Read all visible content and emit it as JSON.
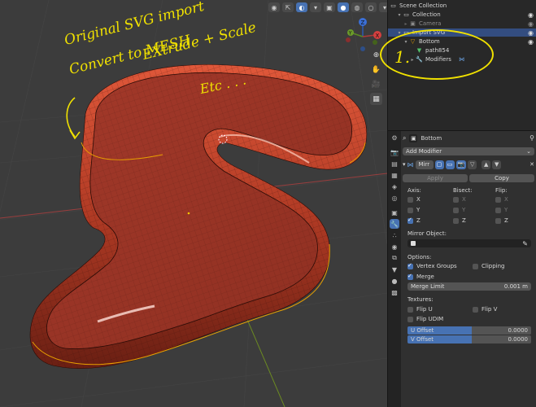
{
  "viewport": {
    "header_icons": [
      "eye-toggle-icon",
      "sphere-shading-icon",
      "overlay-icon",
      "xray-icon",
      "solid-shading-icon",
      "material-shading-icon",
      "rendered-shading-icon"
    ],
    "annotation": {
      "line1": "Original SVG import",
      "line2": "Convert to MESH",
      "line3": "EXtrude + Scale",
      "line4": "Etc . . ."
    },
    "axis_labels": {
      "x": "X",
      "y": "Y",
      "z": "Z"
    }
  },
  "outliner": {
    "rows": [
      {
        "label": "Scene Collection",
        "icon": "collection-icon"
      },
      {
        "label": "Collection",
        "icon": "collection-icon"
      },
      {
        "label": "Camera",
        "icon": "camera-icon"
      },
      {
        "label": "Import SVG",
        "icon": "collection-icon"
      },
      {
        "label": "Bottom",
        "icon": "mesh-object-icon"
      },
      {
        "label": "path854",
        "icon": "mesh-data-icon"
      },
      {
        "label": "Modifiers",
        "icon": "wrench-icon"
      }
    ],
    "annotation_number": "1."
  },
  "properties": {
    "object_name": "Bottom",
    "add_modifier": "Add Modifier",
    "modifier_name": "Mirr",
    "apply": "Apply",
    "copy": "Copy",
    "axis_header": "Axis:",
    "bisect_header": "Bisect:",
    "flip_header": "Flip:",
    "x": "X",
    "y": "Y",
    "z": "Z",
    "mirror_object": "Mirror Object:",
    "options": "Options:",
    "vertex_groups": "Vertex Groups",
    "clipping": "Clipping",
    "merge": "Merge",
    "merge_limit_label": "Merge Limit",
    "merge_limit_value": "0.001 m",
    "textures": "Textures:",
    "flip_u": "Flip U",
    "flip_v": "Flip V",
    "flip_udim": "Flip UDIM",
    "u_offset_label": "U Offset",
    "u_offset_value": "0.0000",
    "v_offset_label": "V Offset",
    "v_offset_value": "0.0000"
  },
  "colors": {
    "accent": "#4772b3",
    "annotation": "#f0e100",
    "mesh": "#c0452e",
    "selected_edge": "#e8a000"
  }
}
